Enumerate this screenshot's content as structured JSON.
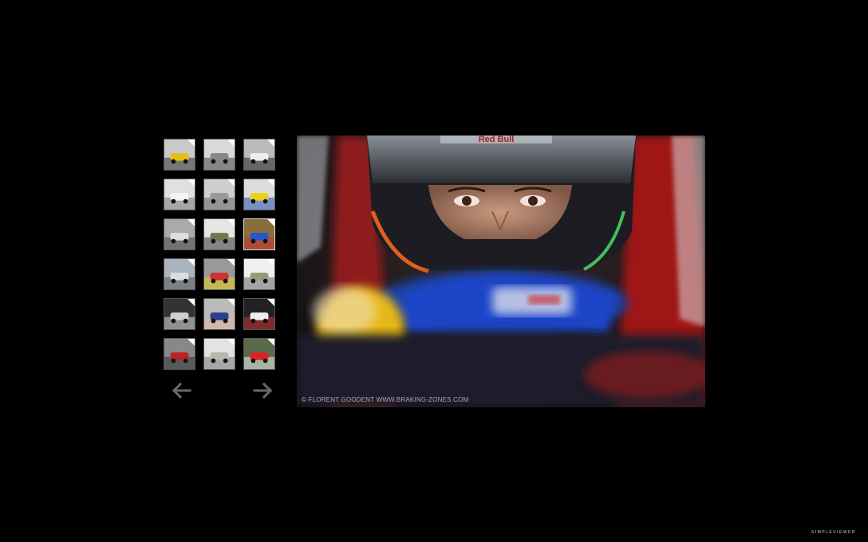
{
  "gallery": {
    "selected_index": 8,
    "thumbnails": [
      {
        "name": "thumb-yellow-car",
        "colors": [
          "#c9c9c9",
          "#e3c018",
          "#333"
        ]
      },
      {
        "name": "thumb-dark-cars-track",
        "colors": [
          "#d9d9d9",
          "#888",
          "#444"
        ]
      },
      {
        "name": "thumb-white-car-corner",
        "colors": [
          "#bbb",
          "#eee",
          "#222"
        ]
      },
      {
        "name": "thumb-white-car-track",
        "colors": [
          "#e0e0e0",
          "#f4f4f4",
          "#777"
        ]
      },
      {
        "name": "thumb-gantry",
        "colors": [
          "#cfcfcf",
          "#999",
          "#666"
        ]
      },
      {
        "name": "thumb-renault-car",
        "colors": [
          "#ddd",
          "#e9d21c",
          "#2b4fb0"
        ]
      },
      {
        "name": "thumb-grey-car",
        "colors": [
          "#aaa",
          "#ddd",
          "#444"
        ]
      },
      {
        "name": "thumb-car-grass",
        "colors": [
          "#e6e6e6",
          "#6d7a50",
          "#333"
        ]
      },
      {
        "name": "thumb-driver-helmet",
        "colors": [
          "#8a6d3b",
          "#2b55c9",
          "#c33"
        ]
      },
      {
        "name": "thumb-cloudy-sky",
        "colors": [
          "#a9b4bf",
          "#d9dde2",
          "#555"
        ]
      },
      {
        "name": "thumb-cars-curve",
        "colors": [
          "#999",
          "#c33",
          "#e9d21c"
        ]
      },
      {
        "name": "thumb-open-field",
        "colors": [
          "#f0f0f0",
          "#9a9a7a",
          "#666"
        ]
      },
      {
        "name": "thumb-ultren-banner",
        "colors": [
          "#333",
          "#cfcfcf",
          "#ddd"
        ]
      },
      {
        "name": "thumb-driver-portrait",
        "colors": [
          "#bbb",
          "#2a3f8f",
          "#e0b89c"
        ]
      },
      {
        "name": "thumb-car-closeup",
        "colors": [
          "#222",
          "#eee",
          "#c33"
        ]
      },
      {
        "name": "thumb-red-car",
        "colors": [
          "#888",
          "#bb2222",
          "#333"
        ]
      },
      {
        "name": "thumb-pale-track",
        "colors": [
          "#e3e3e3",
          "#b9b9a8",
          "#777"
        ]
      },
      {
        "name": "thumb-crew-red",
        "colors": [
          "#5a6b4a",
          "#d22",
          "#eee"
        ]
      }
    ]
  },
  "main_image": {
    "caption": "© FLORENT GOODENT WWW.BRAKING-ZONES.COM",
    "helmet_text": "Red Bull"
  },
  "navigation": {
    "prev_icon": "arrow-left-icon",
    "next_icon": "arrow-right-icon"
  },
  "branding": {
    "label": "SIMPLEVIEWER"
  }
}
